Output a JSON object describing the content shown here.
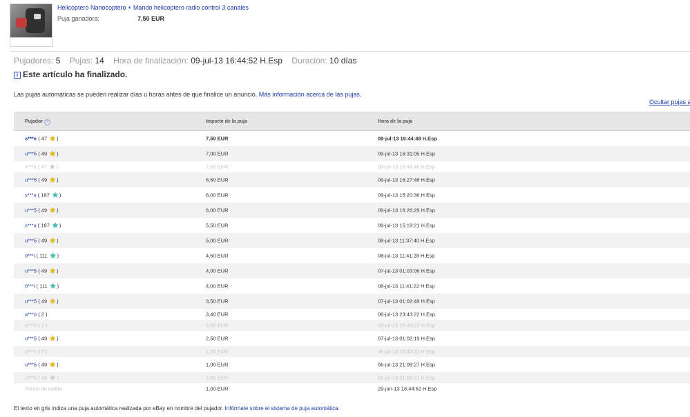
{
  "item": {
    "title": "Helicoptero Nanocoptero + Mando helicoptero radio control 3 canales",
    "winning_bid_label": "Puja ganadora:",
    "winning_bid_amount": "7,50 EUR"
  },
  "stats": {
    "bidders_label": "Pujadores:",
    "bidders_value": "5",
    "bids_label": "Pujas:",
    "bids_value": "14",
    "end_time_label": "Hora de finalización:",
    "end_time_value": "09-jul-13 16:44:52 H.Esp",
    "duration_label": "Duración:",
    "duration_value": "10 días"
  },
  "ended_message": "Este artículo ha finalizado.",
  "note": {
    "text": "Las pujas automáticas se pueden realizar días u horas antes de que finalice un anuncio.",
    "link": "Más información acerca de las pujas."
  },
  "hide_link": "Ocultar pujas a",
  "table": {
    "headers": {
      "bidder": "Pujador",
      "amount": "Importe de la puja",
      "time": "Hora de la puja"
    },
    "rows": [
      {
        "bidder": "s***e",
        "score": "47",
        "star": "yellow",
        "amount": "7,50 EUR",
        "time": "09-jul-13 16:44:48 H.Esp",
        "style": "win",
        "shade": false,
        "h": 22
      },
      {
        "bidder": "u***5",
        "score": "49",
        "star": "yellow",
        "amount": "7,00 EUR",
        "time": "09-jul-13 16:31:05 H.Esp",
        "style": "normal",
        "shade": true,
        "h": 22
      },
      {
        "bidder": "s***e",
        "score": "47",
        "star": "gray",
        "amount": "7,00 EUR",
        "time": "09-jul-13 16:44:48 H.Esp",
        "style": "gray",
        "shade": false,
        "h": 16
      },
      {
        "bidder": "u***5",
        "score": "49",
        "star": "yellow",
        "amount": "6,50 EUR",
        "time": "09-jul-13 16:27:48 H.Esp",
        "style": "normal",
        "shade": true,
        "h": 22
      },
      {
        "bidder": "s***u",
        "score": "187",
        "star": "turquoise",
        "amount": "6,00 EUR",
        "time": "09-jul-13 15:20:36 H.Esp",
        "style": "normal",
        "shade": false,
        "h": 22
      },
      {
        "bidder": "u***5",
        "score": "49",
        "star": "yellow",
        "amount": "6,00 EUR",
        "time": "09-jul-13 16:26:29 H.Esp",
        "style": "normal",
        "shade": true,
        "h": 22
      },
      {
        "bidder": "s***u",
        "score": "187",
        "star": "turquoise",
        "amount": "5,50 EUR",
        "time": "09-jul-13 15:19:21 H.Esp",
        "style": "normal",
        "shade": false,
        "h": 22
      },
      {
        "bidder": "u***5",
        "score": "49",
        "star": "yellow",
        "amount": "5,00 EUR",
        "time": "08-jul-13 11:37:40 H.Esp",
        "style": "normal",
        "shade": true,
        "h": 22
      },
      {
        "bidder": "0***i",
        "score": "111",
        "star": "turquoise",
        "amount": "4,50 EUR",
        "time": "08-jul-13 11:41:28 H.Esp",
        "style": "normal",
        "shade": false,
        "h": 22
      },
      {
        "bidder": "u***5",
        "score": "49",
        "star": "yellow",
        "amount": "4,00 EUR",
        "time": "07-jul-13 01:03:06 H.Esp",
        "style": "normal",
        "shade": true,
        "h": 22
      },
      {
        "bidder": "0***i",
        "score": "111",
        "star": "turquoise",
        "amount": "4,00 EUR",
        "time": "08-jul-13 11:41:22 H.Esp",
        "style": "normal",
        "shade": false,
        "h": 22
      },
      {
        "bidder": "u***5",
        "score": "49",
        "star": "yellow",
        "amount": "3,50 EUR",
        "time": "07-jul-13 01:02:49 H.Esp",
        "style": "normal",
        "shade": true,
        "h": 22
      },
      {
        "bidder": "a***o",
        "score": "2",
        "star": "",
        "amount": "3,40 EUR",
        "time": "06-jul-13 23:43:22 H.Esp",
        "style": "normal",
        "shade": false,
        "h": 16
      },
      {
        "bidder": "a***o",
        "score": "2",
        "star": "",
        "amount": "3,00 EUR",
        "time": "06-jul-13 23:43:22 H.Esp",
        "style": "gray",
        "shade": true,
        "h": 16
      },
      {
        "bidder": "u***5",
        "score": "49",
        "star": "yellow",
        "amount": "2,50 EUR",
        "time": "07-jul-13 01:02:19 H.Esp",
        "style": "normal",
        "shade": false,
        "h": 22
      },
      {
        "bidder": "a***o",
        "score": "2",
        "star": "",
        "amount": "1,50 EUR",
        "time": "06-jul-13 23:43:22 H.Esp",
        "style": "gray",
        "shade": true,
        "h": 16
      },
      {
        "bidder": "u***5",
        "score": "49",
        "star": "yellow",
        "amount": "1,00 EUR",
        "time": "06-jul-13 21:08:27 H.Esp",
        "style": "normal",
        "shade": false,
        "h": 22
      },
      {
        "bidder": "u***5",
        "score": "49",
        "star": "gray",
        "amount": "1,00 EUR",
        "time": "06-jul-13 21:08:27 H.Esp",
        "style": "gray",
        "shade": true,
        "h": 16
      },
      {
        "bidder": "Precio de salida",
        "score": "",
        "star": "",
        "amount": "1,00 EUR",
        "time": "29-jun-13 16:44:52 H.Esp",
        "style": "start",
        "shade": false,
        "h": 16
      }
    ]
  },
  "footer": {
    "text": "El texto en gris indica una puja automática realizada por eBay en nombre del pujador.",
    "link": "Infórmate sobre el sistema de puja automática."
  }
}
